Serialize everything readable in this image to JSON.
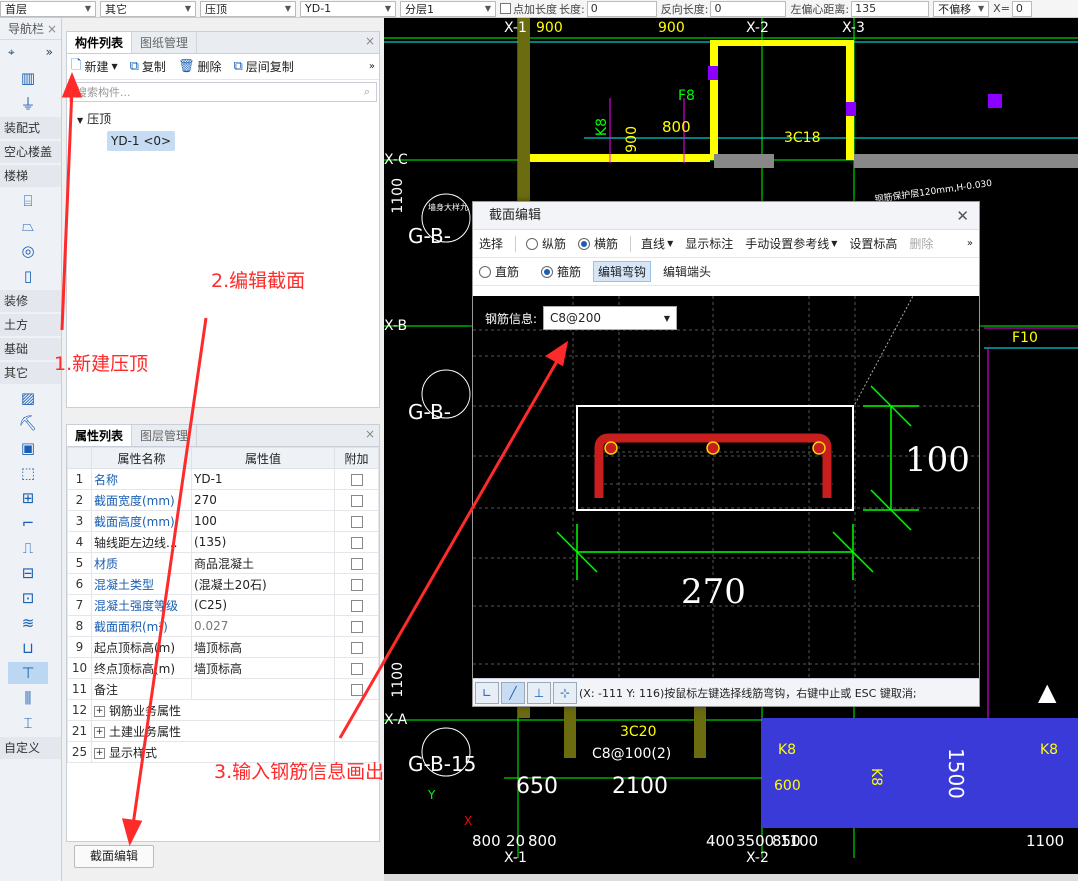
{
  "toolbar": {
    "floor": "首层",
    "type": "其它",
    "component": "压顶",
    "instance": "YD-1",
    "layer": "分层1",
    "point_len_label": "点加长度",
    "length_label": "长度:",
    "length_value": "0",
    "reverse_label": "反向长度:",
    "reverse_value": "0",
    "offset_label": "左偏心距离:",
    "offset_value": "135",
    "no_offset": "不偏移",
    "x_label": "X=",
    "x_value": "0"
  },
  "nav": {
    "title": "导航栏",
    "categories": {
      "prefab": "装配式",
      "hollow": "空心楼盖",
      "stairs": "楼梯",
      "decor": "装修",
      "earth": "土方",
      "foundation": "基础",
      "other": "其它",
      "custom": "自定义"
    }
  },
  "component_panel": {
    "tabs": [
      "构件列表",
      "图纸管理"
    ],
    "new_label": "新建",
    "copy_label": "复制",
    "delete_label": "删除",
    "floor_copy_label": "层间复制",
    "search_placeholder": "搜索构件...",
    "tree_root": "压顶",
    "tree_item": "YD-1 <0>"
  },
  "property_panel": {
    "tabs": [
      "属性列表",
      "图层管理"
    ],
    "headers": [
      "属性名称",
      "属性值",
      "附加"
    ],
    "rows": [
      {
        "num": "1",
        "name": "名称",
        "value": "YD-1"
      },
      {
        "num": "2",
        "name": "截面宽度(mm)",
        "value": "270"
      },
      {
        "num": "3",
        "name": "截面高度(mm)",
        "value": "100"
      },
      {
        "num": "4",
        "name": "轴线距左边线...",
        "value": "(135)"
      },
      {
        "num": "5",
        "name": "材质",
        "value": "商品混凝土"
      },
      {
        "num": "6",
        "name": "混凝土类型",
        "value": "(混凝土20石)"
      },
      {
        "num": "7",
        "name": "混凝土强度等级",
        "value": "(C25)"
      },
      {
        "num": "8",
        "name": "截面面积(m²)",
        "value": "0.027"
      },
      {
        "num": "9",
        "name": "起点顶标高(m)",
        "value": "墙顶标高"
      },
      {
        "num": "10",
        "name": "终点顶标高(m)",
        "value": "墙顶标高"
      },
      {
        "num": "11",
        "name": "备注",
        "value": ""
      },
      {
        "num": "12",
        "name": "钢筋业务属性",
        "value": ""
      },
      {
        "num": "21",
        "name": "土建业务属性",
        "value": ""
      },
      {
        "num": "25",
        "name": "显示样式",
        "value": ""
      }
    ],
    "section_edit_button": "截面编辑"
  },
  "dialog": {
    "title": "截面编辑",
    "select_label": "选择",
    "longitudinal": "纵筋",
    "transverse": "横筋",
    "line_mode": "直线",
    "show_annot": "显示标注",
    "manual_ref": "手动设置参考线",
    "set_elev": "设置标高",
    "delete": "删除",
    "straight": "直筋",
    "stirrup": "箍筋",
    "edit_bend": "编辑弯钩",
    "edit_end": "编辑端头",
    "steel_info_label": "钢筋信息:",
    "steel_info_value": "C8@200",
    "dim_width": "270",
    "dim_height": "100",
    "status_text": "(X: -111 Y: 116)按鼠标左键选择线筋弯钩，右键中止或 ESC 键取消;"
  },
  "cad": {
    "axes_top": [
      "X-1",
      "X-2",
      "X-3"
    ],
    "axes_left": [
      "X-C",
      "X-B",
      "X-A"
    ],
    "axes_bottom": [
      "X-1",
      "X-2"
    ],
    "dims_top": [
      "900",
      "900"
    ],
    "dims_bottom": [
      "800",
      "20",
      "800",
      "400",
      "3500",
      "850",
      "1100",
      "1100"
    ],
    "dims_left": [
      "1100",
      "1100"
    ],
    "dims_mid": [
      "650",
      "2100",
      "1500",
      "600"
    ],
    "labels": [
      "F8",
      "800",
      "K8",
      "900",
      "3C18",
      "F10",
      "3C20",
      "C8@100(2)",
      "K8",
      "K8",
      "K8"
    ],
    "wall_tags": [
      "G-B-",
      "G-B-",
      "G-B-15"
    ],
    "wall_note": "墙身大样九",
    "note_top": "钢筋保护层120mm,H-0.030"
  },
  "annotations": {
    "step1": "1.新建压顶",
    "step2": "2.编辑截面",
    "step3": "3.输入钢筋信息画出"
  }
}
